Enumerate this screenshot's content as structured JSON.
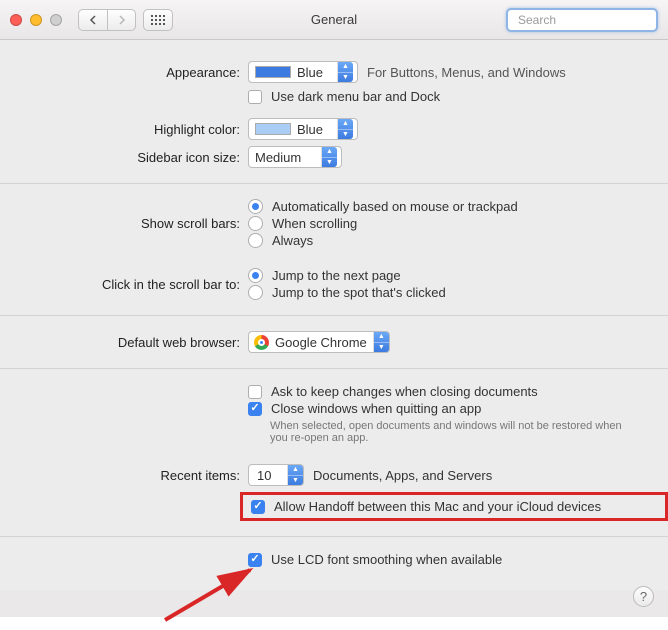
{
  "title": "General",
  "search_placeholder": "Search",
  "labels": {
    "appearance": "Appearance:",
    "highlight": "Highlight color:",
    "sidebar": "Sidebar icon size:",
    "scrollbars": "Show scroll bars:",
    "clickbar": "Click in the scroll bar to:",
    "browser": "Default web browser:",
    "recent": "Recent items:"
  },
  "appearance": {
    "value": "Blue",
    "hint": "For Buttons, Menus, and Windows",
    "darkmenu": "Use dark menu bar and Dock"
  },
  "highlight_value": "Blue",
  "sidebar_value": "Medium",
  "scroll_opts": {
    "auto": "Automatically based on mouse or trackpad",
    "when": "When scrolling",
    "always": "Always"
  },
  "click_opts": {
    "next": "Jump to the next page",
    "spot": "Jump to the spot that's clicked"
  },
  "browser_value": "Google Chrome",
  "docs": {
    "ask": "Ask to keep changes when closing documents",
    "close": "Close windows when quitting an app",
    "close_note": "When selected, open documents and windows will not be restored when you re-open an app."
  },
  "recent": {
    "value": "10",
    "suffix": "Documents, Apps, and Servers"
  },
  "handoff": "Allow Handoff between this Mac and your iCloud devices",
  "lcd": "Use LCD font smoothing when available",
  "help": "?"
}
